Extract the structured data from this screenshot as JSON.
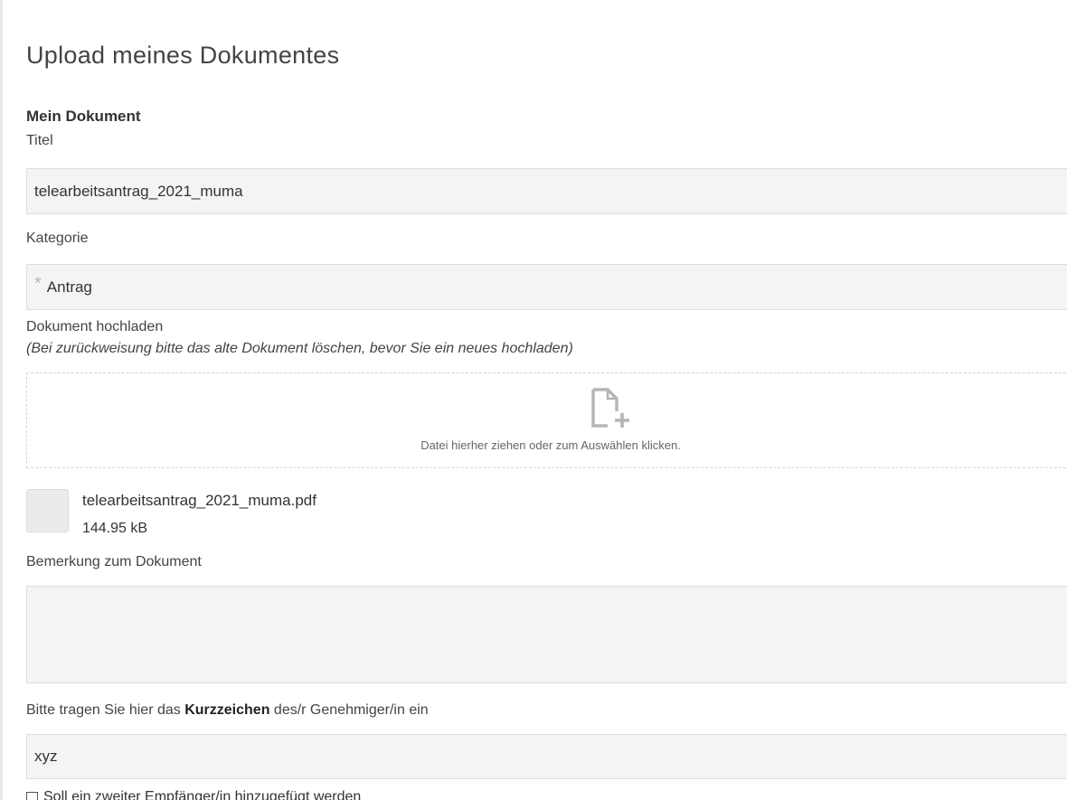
{
  "page": {
    "title": "Upload meines Dokumentes"
  },
  "document": {
    "section_title": "Mein Dokument",
    "title_label": "Titel",
    "title_value": "telearbeitsantrag_2021_muma",
    "category_label": "Kategorie",
    "category_value": "Antrag",
    "upload_label": "Dokument hochladen",
    "upload_hint": "(Bei zurückweisung bitte das alte Dokument löschen, bevor Sie ein neues hochladen)",
    "dropzone_text": "Datei hierher ziehen oder zum Auswählen klicken.",
    "file": {
      "name": "telearbeitsantrag_2021_muma.pdf",
      "size": "144.95 kB"
    },
    "remark_label": "Bemerkung zum Dokument",
    "remark_value": "",
    "approver_label_prefix": "Bitte tragen Sie hier das ",
    "approver_label_bold": "Kurzzeichen",
    "approver_label_suffix": " des/r Genehmiger/in ein",
    "approver_value": "xyz",
    "second_recipient_label": "Soll ein zweiter Empfänger/in hinzugefügt werden",
    "second_recipient_checked": false
  },
  "icons": {
    "dropzone": "file-add-icon",
    "required": "asterisk-icon"
  },
  "colors": {
    "field_background": "#f4f4f4",
    "field_border": "#dedede",
    "dropzone_border": "#d6d6d6",
    "icon": "#b5b5b5"
  }
}
